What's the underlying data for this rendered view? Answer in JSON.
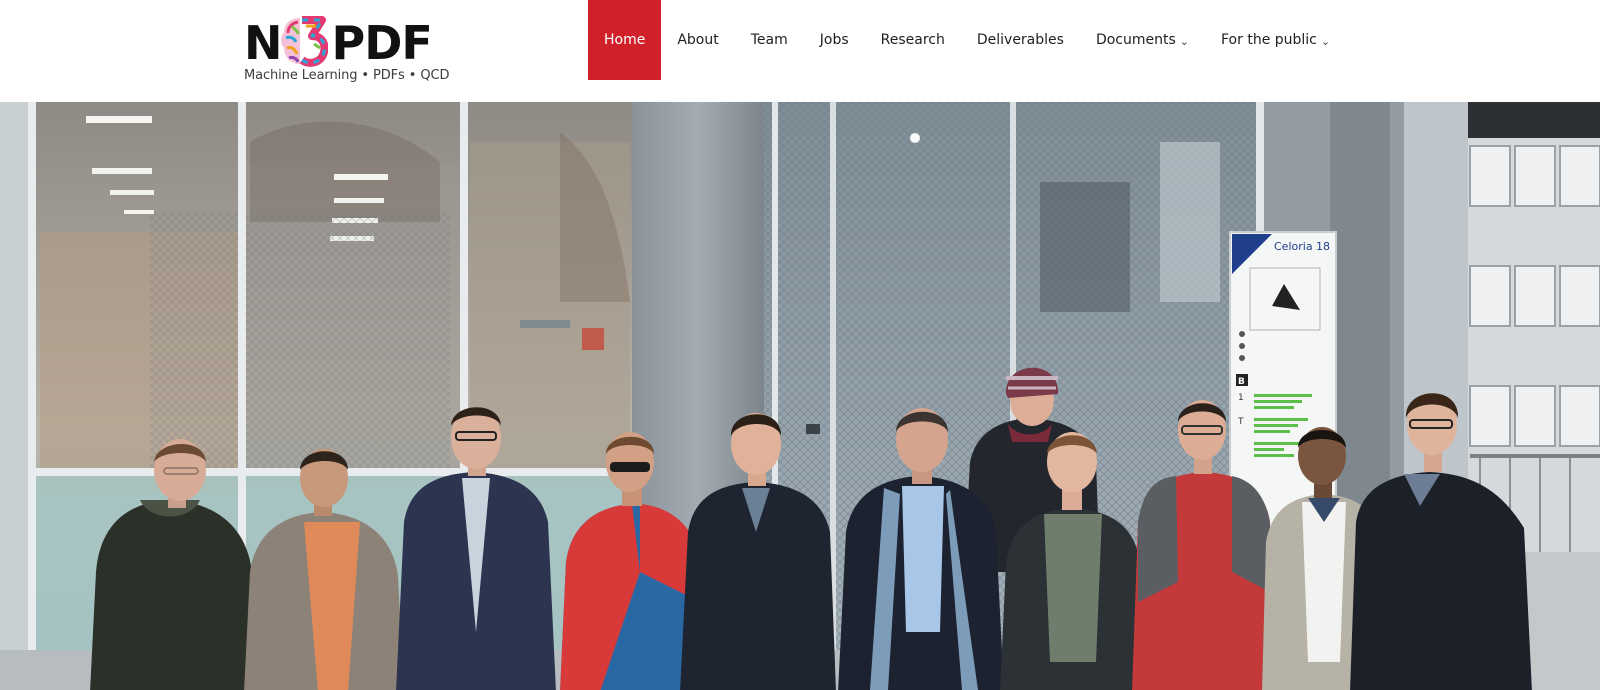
{
  "logo": {
    "wordmark_left": "N",
    "wordmark_right": "PDF",
    "tagline": "Machine Learning • PDFs • QCD",
    "mark_icon": "brain-3-colorful-icon"
  },
  "nav": {
    "items": [
      {
        "label": "Home",
        "active": true,
        "dropdown": false
      },
      {
        "label": "About",
        "active": false,
        "dropdown": false
      },
      {
        "label": "Team",
        "active": false,
        "dropdown": false
      },
      {
        "label": "Jobs",
        "active": false,
        "dropdown": false
      },
      {
        "label": "Research",
        "active": false,
        "dropdown": false
      },
      {
        "label": "Deliverables",
        "active": false,
        "dropdown": false
      },
      {
        "label": "Documents",
        "active": false,
        "dropdown": true
      },
      {
        "label": "For the public",
        "active": false,
        "dropdown": true
      }
    ],
    "dropdown_icon": "chevron-down-icon",
    "active_color": "#d0202a"
  },
  "hero": {
    "sign_title": "Celoria 18",
    "sign_floor_letters": [
      "B",
      "1",
      "T"
    ]
  }
}
